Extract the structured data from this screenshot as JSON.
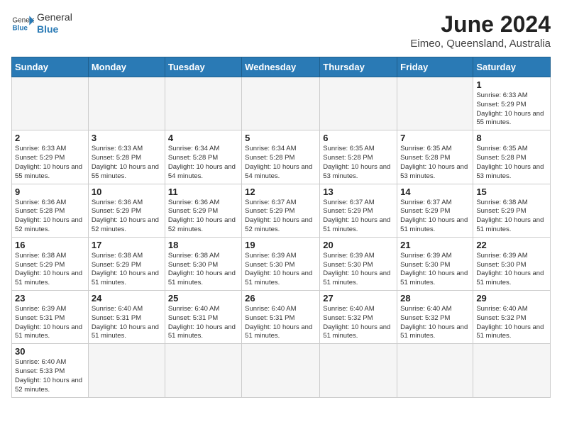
{
  "header": {
    "logo_general": "General",
    "logo_blue": "Blue",
    "title": "June 2024",
    "subtitle": "Eimeo, Queensland, Australia"
  },
  "weekdays": [
    "Sunday",
    "Monday",
    "Tuesday",
    "Wednesday",
    "Thursday",
    "Friday",
    "Saturday"
  ],
  "weeks": [
    [
      {
        "day": "",
        "info": ""
      },
      {
        "day": "",
        "info": ""
      },
      {
        "day": "",
        "info": ""
      },
      {
        "day": "",
        "info": ""
      },
      {
        "day": "",
        "info": ""
      },
      {
        "day": "",
        "info": ""
      },
      {
        "day": "1",
        "info": "Sunrise: 6:33 AM\nSunset: 5:29 PM\nDaylight: 10 hours and 55 minutes."
      }
    ],
    [
      {
        "day": "2",
        "info": "Sunrise: 6:33 AM\nSunset: 5:29 PM\nDaylight: 10 hours and 55 minutes."
      },
      {
        "day": "3",
        "info": "Sunrise: 6:33 AM\nSunset: 5:28 PM\nDaylight: 10 hours and 55 minutes."
      },
      {
        "day": "4",
        "info": "Sunrise: 6:34 AM\nSunset: 5:28 PM\nDaylight: 10 hours and 54 minutes."
      },
      {
        "day": "5",
        "info": "Sunrise: 6:34 AM\nSunset: 5:28 PM\nDaylight: 10 hours and 54 minutes."
      },
      {
        "day": "6",
        "info": "Sunrise: 6:35 AM\nSunset: 5:28 PM\nDaylight: 10 hours and 53 minutes."
      },
      {
        "day": "7",
        "info": "Sunrise: 6:35 AM\nSunset: 5:28 PM\nDaylight: 10 hours and 53 minutes."
      },
      {
        "day": "8",
        "info": "Sunrise: 6:35 AM\nSunset: 5:28 PM\nDaylight: 10 hours and 53 minutes."
      }
    ],
    [
      {
        "day": "9",
        "info": "Sunrise: 6:36 AM\nSunset: 5:28 PM\nDaylight: 10 hours and 52 minutes."
      },
      {
        "day": "10",
        "info": "Sunrise: 6:36 AM\nSunset: 5:29 PM\nDaylight: 10 hours and 52 minutes."
      },
      {
        "day": "11",
        "info": "Sunrise: 6:36 AM\nSunset: 5:29 PM\nDaylight: 10 hours and 52 minutes."
      },
      {
        "day": "12",
        "info": "Sunrise: 6:37 AM\nSunset: 5:29 PM\nDaylight: 10 hours and 52 minutes."
      },
      {
        "day": "13",
        "info": "Sunrise: 6:37 AM\nSunset: 5:29 PM\nDaylight: 10 hours and 51 minutes."
      },
      {
        "day": "14",
        "info": "Sunrise: 6:37 AM\nSunset: 5:29 PM\nDaylight: 10 hours and 51 minutes."
      },
      {
        "day": "15",
        "info": "Sunrise: 6:38 AM\nSunset: 5:29 PM\nDaylight: 10 hours and 51 minutes."
      }
    ],
    [
      {
        "day": "16",
        "info": "Sunrise: 6:38 AM\nSunset: 5:29 PM\nDaylight: 10 hours and 51 minutes."
      },
      {
        "day": "17",
        "info": "Sunrise: 6:38 AM\nSunset: 5:29 PM\nDaylight: 10 hours and 51 minutes."
      },
      {
        "day": "18",
        "info": "Sunrise: 6:38 AM\nSunset: 5:30 PM\nDaylight: 10 hours and 51 minutes."
      },
      {
        "day": "19",
        "info": "Sunrise: 6:39 AM\nSunset: 5:30 PM\nDaylight: 10 hours and 51 minutes."
      },
      {
        "day": "20",
        "info": "Sunrise: 6:39 AM\nSunset: 5:30 PM\nDaylight: 10 hours and 51 minutes."
      },
      {
        "day": "21",
        "info": "Sunrise: 6:39 AM\nSunset: 5:30 PM\nDaylight: 10 hours and 51 minutes."
      },
      {
        "day": "22",
        "info": "Sunrise: 6:39 AM\nSunset: 5:30 PM\nDaylight: 10 hours and 51 minutes."
      }
    ],
    [
      {
        "day": "23",
        "info": "Sunrise: 6:39 AM\nSunset: 5:31 PM\nDaylight: 10 hours and 51 minutes."
      },
      {
        "day": "24",
        "info": "Sunrise: 6:40 AM\nSunset: 5:31 PM\nDaylight: 10 hours and 51 minutes."
      },
      {
        "day": "25",
        "info": "Sunrise: 6:40 AM\nSunset: 5:31 PM\nDaylight: 10 hours and 51 minutes."
      },
      {
        "day": "26",
        "info": "Sunrise: 6:40 AM\nSunset: 5:31 PM\nDaylight: 10 hours and 51 minutes."
      },
      {
        "day": "27",
        "info": "Sunrise: 6:40 AM\nSunset: 5:32 PM\nDaylight: 10 hours and 51 minutes."
      },
      {
        "day": "28",
        "info": "Sunrise: 6:40 AM\nSunset: 5:32 PM\nDaylight: 10 hours and 51 minutes."
      },
      {
        "day": "29",
        "info": "Sunrise: 6:40 AM\nSunset: 5:32 PM\nDaylight: 10 hours and 51 minutes."
      }
    ],
    [
      {
        "day": "30",
        "info": "Sunrise: 6:40 AM\nSunset: 5:33 PM\nDaylight: 10 hours and 52 minutes."
      },
      {
        "day": "",
        "info": ""
      },
      {
        "day": "",
        "info": ""
      },
      {
        "day": "",
        "info": ""
      },
      {
        "day": "",
        "info": ""
      },
      {
        "day": "",
        "info": ""
      },
      {
        "day": "",
        "info": ""
      }
    ]
  ]
}
